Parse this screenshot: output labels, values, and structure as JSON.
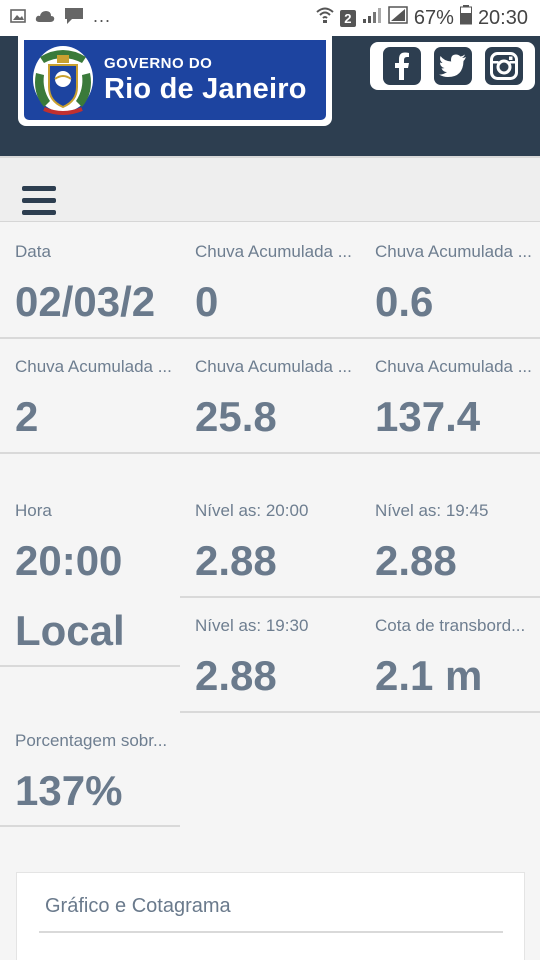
{
  "statusbar": {
    "left_icons": [
      "image-icon",
      "cloud-icon",
      "chat-icon"
    ],
    "dots": "...",
    "sim": "2",
    "battery": "67%",
    "time": "20:30"
  },
  "header": {
    "logo_small": "GOVERNO DO",
    "logo_big": "Rio de Janeiro",
    "social": [
      "facebook-icon",
      "twitter-icon",
      "instagram-icon"
    ],
    "bg": "#2d3e50",
    "logo_blue": "#1d44a0"
  },
  "cells": [
    {
      "label": "Data",
      "value": "02/03/2"
    },
    {
      "label": "Chuva Acumulada ...",
      "value": "0"
    },
    {
      "label": "Chuva Acumulada ...",
      "value": "0.6"
    },
    {
      "label": "Chuva Acumulada ...",
      "value": "2"
    },
    {
      "label": "Chuva Acumulada ...",
      "value": "25.8"
    },
    {
      "label": "Chuva Acumulada ...",
      "value": "137.4"
    },
    {
      "label": "Hora",
      "value": "20:00",
      "value2": "Local"
    },
    {
      "label": "Nível as: 20:00",
      "value": "2.88"
    },
    {
      "label": "Nível as: 19:45",
      "value": "2.88"
    },
    {
      "label": "Nível as: 19:30",
      "value": "2.88"
    },
    {
      "label": "Cota de transbord...",
      "value": "2.1 m"
    },
    {
      "label": "Porcentagem sobr...",
      "value": "137%"
    }
  ],
  "card": {
    "title": "Gráfico e Cotagrama"
  }
}
